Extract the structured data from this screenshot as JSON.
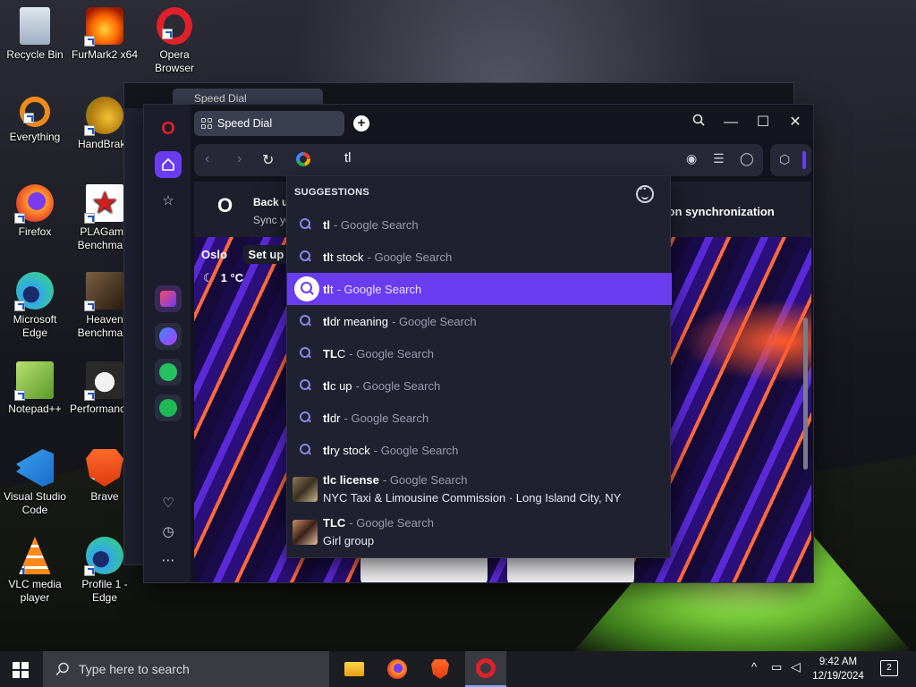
{
  "desktop": {
    "icons": [
      {
        "label": "Recycle Bin",
        "icon": "recycle-bin-icon"
      },
      {
        "label": "FurMark2 x64",
        "icon": "furmark-icon"
      },
      {
        "label": "Opera Browser",
        "icon": "opera-icon"
      },
      {
        "label": "Everything",
        "icon": "everything-icon"
      },
      {
        "label": "HandBrake",
        "icon": "handbrake-icon"
      },
      {
        "label": "Firefox",
        "icon": "firefox-icon"
      },
      {
        "label": "PLAGame Benchmark",
        "icon": "plagame-icon"
      },
      {
        "label": "Microsoft Edge",
        "icon": "edge-icon"
      },
      {
        "label": "Heaven Benchmark",
        "icon": "heaven-icon"
      },
      {
        "label": "Notepad++",
        "icon": "notepadpp-icon"
      },
      {
        "label": "PerformanceTest",
        "icon": "performancetest-icon"
      },
      {
        "label": "Visual Studio Code",
        "icon": "vscode-icon"
      },
      {
        "label": "Brave",
        "icon": "brave-icon"
      },
      {
        "label": "VLC media player",
        "icon": "vlc-icon"
      },
      {
        "label": "Profile 1 - Edge",
        "icon": "edge-profile-icon"
      }
    ]
  },
  "back_window": {
    "tab_label": "Speed Dial"
  },
  "browser": {
    "tab_label": "Speed Dial",
    "new_tab_label": "+",
    "address_value": "tl",
    "sync_title": "Back u",
    "sync_sub": "Sync yo",
    "sync_right": "n on synchronization",
    "weather_city": "Oslo",
    "setup_label": "Set up",
    "temperature": "1 °C"
  },
  "suggestions": {
    "heading": "SUGGESTIONS",
    "items": [
      {
        "bold": "tl",
        "rest": "",
        "suffix": "- Google Search"
      },
      {
        "bold": "tl",
        "rest": "t stock",
        "suffix": "- Google Search"
      },
      {
        "bold": "tl",
        "rest": "t",
        "suffix": "- Google Search",
        "selected": true
      },
      {
        "bold": "tl",
        "rest": "dr meaning",
        "suffix": "- Google Search"
      },
      {
        "bold": "TL",
        "rest": "C",
        "suffix": "- Google Search"
      },
      {
        "bold": "tl",
        "rest": "c up",
        "suffix": "- Google Search"
      },
      {
        "bold": "tl",
        "rest": "dr",
        "suffix": "- Google Search"
      },
      {
        "bold": "tl",
        "rest": "ry stock",
        "suffix": "- Google Search"
      }
    ],
    "rich": [
      {
        "title": "tlc license",
        "suffix": "- Google Search",
        "sub": "NYC Taxi & Limousine Commission · Long Island City, NY"
      },
      {
        "title": "TLC",
        "suffix": "- Google Search",
        "sub": "Girl group"
      }
    ]
  },
  "taskbar": {
    "search_placeholder": "Type here to search",
    "time": "9:42 AM",
    "date": "12/19/2024",
    "notification_count": "2"
  },
  "colors": {
    "accent": "#6a3cf0",
    "opera_red": "#e0202a"
  }
}
